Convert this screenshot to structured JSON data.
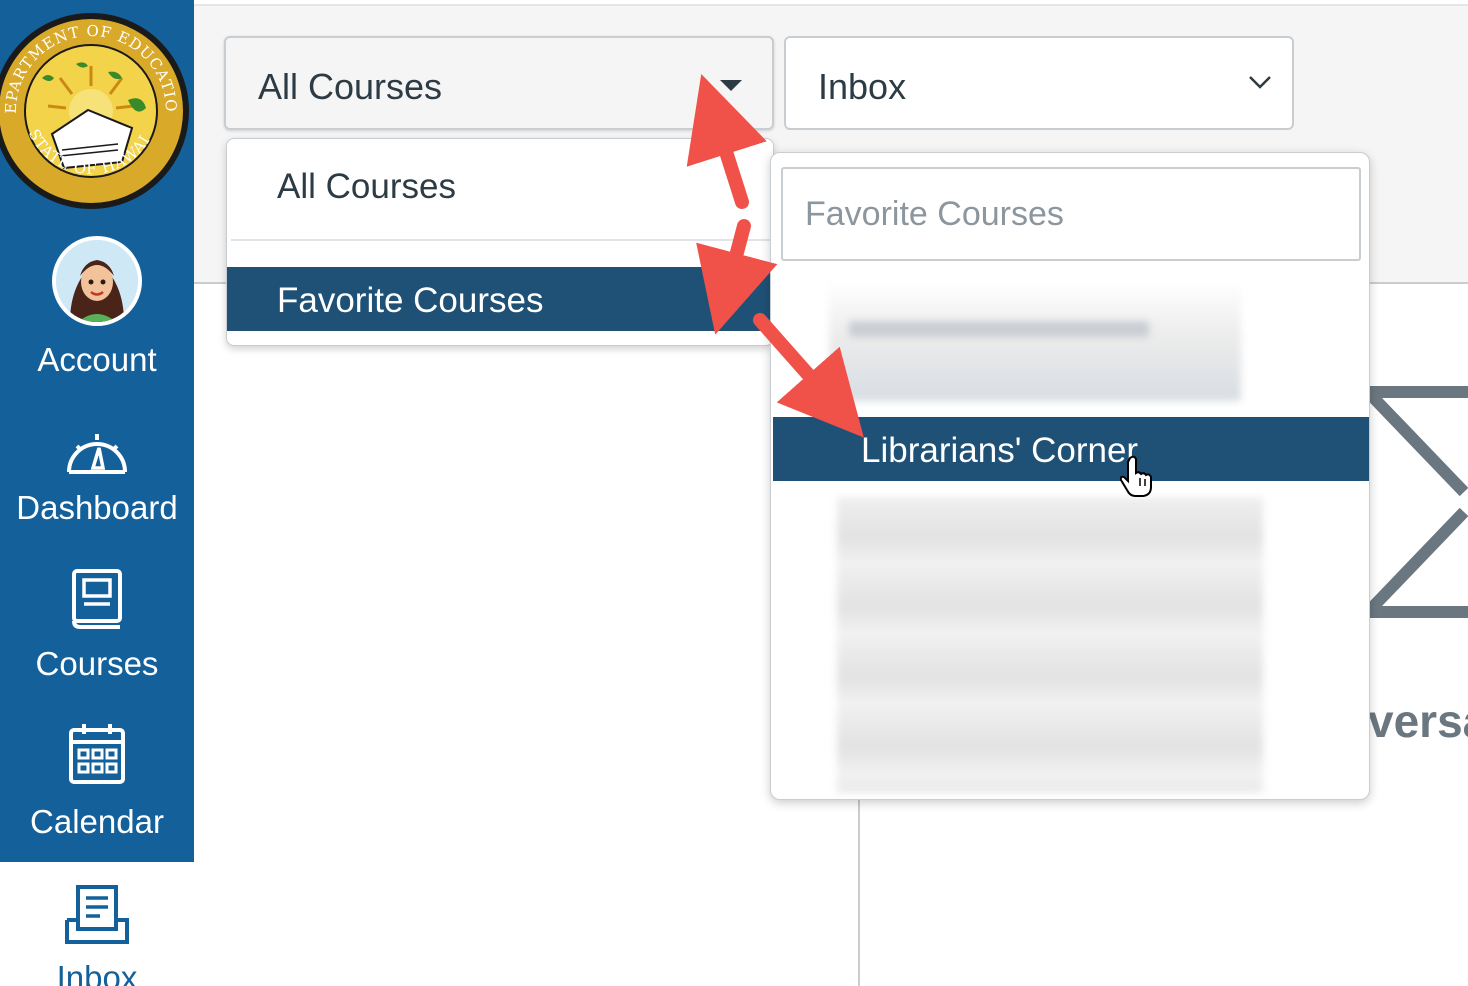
{
  "nav": {
    "logo_text": "DEPARTMENT OF EDUCATION · STATE OF HAWAII",
    "items": [
      {
        "label": "Account",
        "icon": "avatar"
      },
      {
        "label": "Dashboard",
        "icon": "dashboard-icon"
      },
      {
        "label": "Courses",
        "icon": "courses-icon"
      },
      {
        "label": "Calendar",
        "icon": "calendar-icon"
      },
      {
        "label": "Inbox",
        "icon": "inbox-icon",
        "active": true
      }
    ],
    "colors": {
      "background": "#13609b",
      "text": "#ffffff"
    }
  },
  "header": {
    "course_filter": {
      "value": "All Courses"
    },
    "mailbox_filter": {
      "value": "Inbox"
    }
  },
  "course_menu": {
    "items": [
      {
        "label": "All Courses"
      },
      {
        "label": "Favorite Courses",
        "selected": true,
        "has_submenu": true
      }
    ],
    "highlight_color": "#1f5176"
  },
  "favorites_submenu": {
    "search_placeholder": "Favorite Courses",
    "items": [
      {
        "label": "Librarians' Corner",
        "highlighted": true
      }
    ]
  },
  "main": {
    "empty_state_partial": "versa"
  },
  "annotations": {
    "arrow_color": "#f0524a"
  }
}
